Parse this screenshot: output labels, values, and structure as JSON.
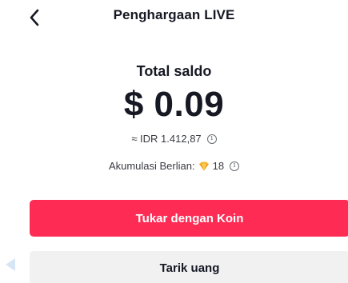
{
  "header": {
    "back_icon": "chevron-left-icon",
    "title": "Penghargaan LIVE"
  },
  "balance": {
    "label": "Total saldo",
    "amount": "$ 0.09",
    "idr_text": "≈ IDR 1.412,87",
    "diamonds_label": "Akumulasi Berlian:",
    "diamonds_icon": "diamond-icon",
    "diamonds_count": "18",
    "info_icon": "info-icon"
  },
  "actions": {
    "exchange_label": "Tukar dengan Koin",
    "withdraw_label": "Tarik uang"
  },
  "colors": {
    "accent": "#fe2c55",
    "secondary_button_bg": "#f1f1f2",
    "text": "#161823",
    "diamond": "#f6b93b"
  }
}
